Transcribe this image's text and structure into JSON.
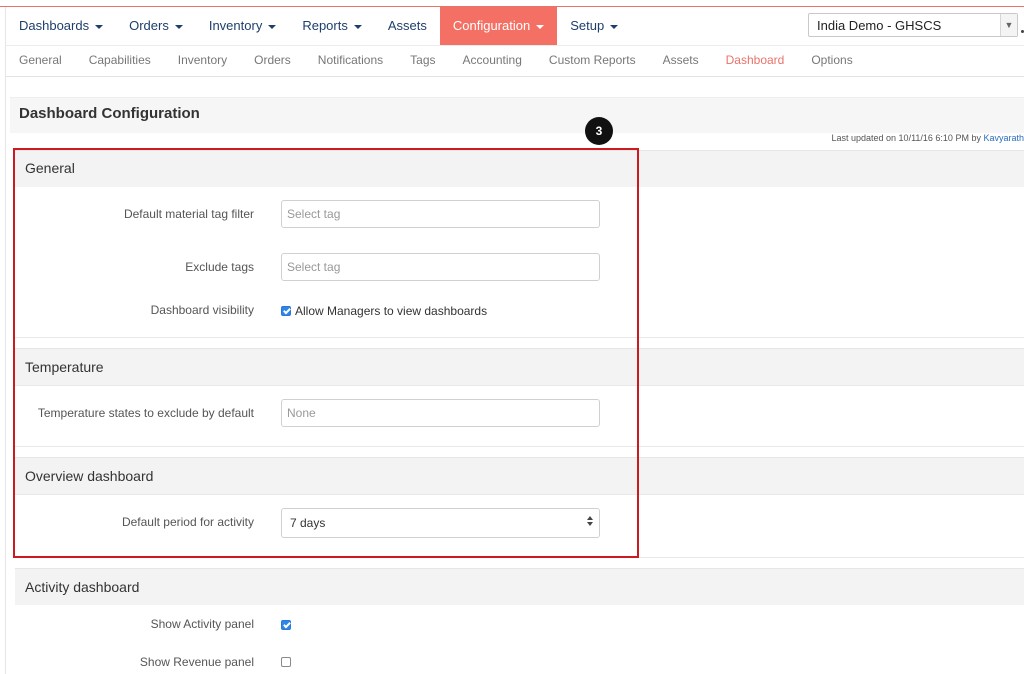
{
  "main_nav": {
    "items": [
      {
        "label": "Dashboards",
        "dropdown": true
      },
      {
        "label": "Orders",
        "dropdown": true
      },
      {
        "label": "Inventory",
        "dropdown": true
      },
      {
        "label": "Reports",
        "dropdown": true
      },
      {
        "label": "Assets",
        "dropdown": false
      },
      {
        "label": "Configuration",
        "dropdown": true,
        "active": true
      },
      {
        "label": "Setup",
        "dropdown": true
      }
    ],
    "domain_select": {
      "value": "India Demo - GHSCS"
    }
  },
  "sub_nav": {
    "items": [
      "General",
      "Capabilities",
      "Inventory",
      "Orders",
      "Notifications",
      "Tags",
      "Accounting",
      "Custom Reports",
      "Assets",
      "Dashboard",
      "Options"
    ],
    "active": "Dashboard"
  },
  "page": {
    "title": "Dashboard Configuration",
    "last_updated_prefix": "Last updated on 10/11/16 6:10 PM by",
    "last_updated_user": "Kavyarath",
    "step_badge": "3"
  },
  "sections": {
    "general": {
      "title": "General",
      "material_tag_label": "Default material tag filter",
      "material_tag_placeholder": "Select tag",
      "exclude_tags_label": "Exclude tags",
      "exclude_tags_placeholder": "Select tag",
      "visibility_label": "Dashboard visibility",
      "visibility_checkbox_label": "Allow Managers to view dashboards",
      "visibility_checked": true
    },
    "temperature": {
      "title": "Temperature",
      "exclude_states_label": "Temperature states to exclude by default",
      "exclude_states_value": "None"
    },
    "overview": {
      "title": "Overview dashboard",
      "period_label": "Default period for activity",
      "period_value": "7 days"
    },
    "activity": {
      "title": "Activity dashboard",
      "show_activity_label": "Show Activity panel",
      "show_activity_checked": true,
      "show_revenue_label": "Show Revenue panel",
      "show_revenue_checked": false
    }
  },
  "colors": {
    "accent": "#f47064",
    "nav_text": "#1d3f6b",
    "highlight_border": "#cc1b1f",
    "checkbox_on": "#2f86e8"
  }
}
